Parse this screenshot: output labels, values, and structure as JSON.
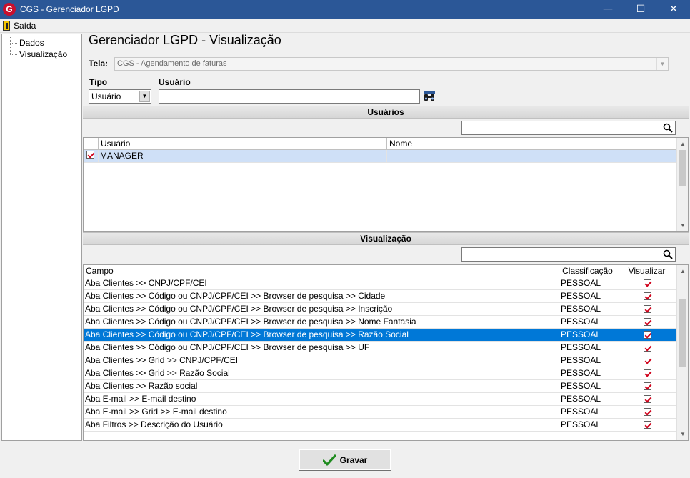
{
  "window": {
    "title": "CGS - Gerenciador LGPD",
    "app_icon_letter": "G",
    "minimize": "—",
    "maximize": "☐",
    "close": "✕"
  },
  "menu": {
    "exit_label": "Saída"
  },
  "tree": {
    "items": [
      "Dados",
      "Visualização"
    ]
  },
  "header": {
    "title": "Gerenciador LGPD - Visualização"
  },
  "tela": {
    "label": "Tela:",
    "value": "CGS - Agendamento de faturas"
  },
  "tipo": {
    "label": "Tipo",
    "value": "Usuário"
  },
  "usuario": {
    "label": "Usuário",
    "value": ""
  },
  "usuarios_section": {
    "title": "Usuários",
    "search_value": "",
    "columns": [
      "Usuário",
      "Nome"
    ],
    "rows": [
      {
        "checked": true,
        "usuario": "MANAGER",
        "nome": ""
      }
    ]
  },
  "visualizacao_section": {
    "title": "Visualização",
    "search_value": "",
    "columns": [
      "Campo",
      "Classificação",
      "Visualizar"
    ],
    "rows": [
      {
        "campo": "Aba Clientes >> CNPJ/CPF/CEI",
        "classificacao": "PESSOAL",
        "visualizar": true
      },
      {
        "campo": "Aba Clientes >> Código ou CNPJ/CPF/CEI >> Browser de pesquisa >> Cidade",
        "classificacao": "PESSOAL",
        "visualizar": true
      },
      {
        "campo": "Aba Clientes >> Código ou CNPJ/CPF/CEI >> Browser de pesquisa >> Inscrição",
        "classificacao": "PESSOAL",
        "visualizar": true
      },
      {
        "campo": "Aba Clientes >> Código ou CNPJ/CPF/CEI >> Browser de pesquisa >> Nome Fantasia",
        "classificacao": "PESSOAL",
        "visualizar": true
      },
      {
        "campo": "Aba Clientes >> Código ou CNPJ/CPF/CEI >> Browser de pesquisa >> Razão Social",
        "classificacao": "PESSOAL",
        "visualizar": true,
        "selected": true
      },
      {
        "campo": "Aba Clientes >> Código ou CNPJ/CPF/CEI >> Browser de pesquisa >> UF",
        "classificacao": "PESSOAL",
        "visualizar": true
      },
      {
        "campo": "Aba Clientes >> Grid >> CNPJ/CPF/CEI",
        "classificacao": "PESSOAL",
        "visualizar": true
      },
      {
        "campo": "Aba Clientes >> Grid >> Razão Social",
        "classificacao": "PESSOAL",
        "visualizar": true
      },
      {
        "campo": "Aba Clientes >> Razão social",
        "classificacao": "PESSOAL",
        "visualizar": true
      },
      {
        "campo": "Aba E-mail >> E-mail destino",
        "classificacao": "PESSOAL",
        "visualizar": true
      },
      {
        "campo": "Aba E-mail >> Grid >> E-mail destino",
        "classificacao": "PESSOAL",
        "visualizar": true
      },
      {
        "campo": "Aba Filtros >> Descrição do Usuário",
        "classificacao": "PESSOAL",
        "visualizar": true
      }
    ]
  },
  "footer": {
    "save_label": "Gravar"
  },
  "colors": {
    "titlebar": "#2b5797",
    "selection": "#0078d7",
    "check": "#d0021b",
    "save_check": "#1e8b1e"
  }
}
